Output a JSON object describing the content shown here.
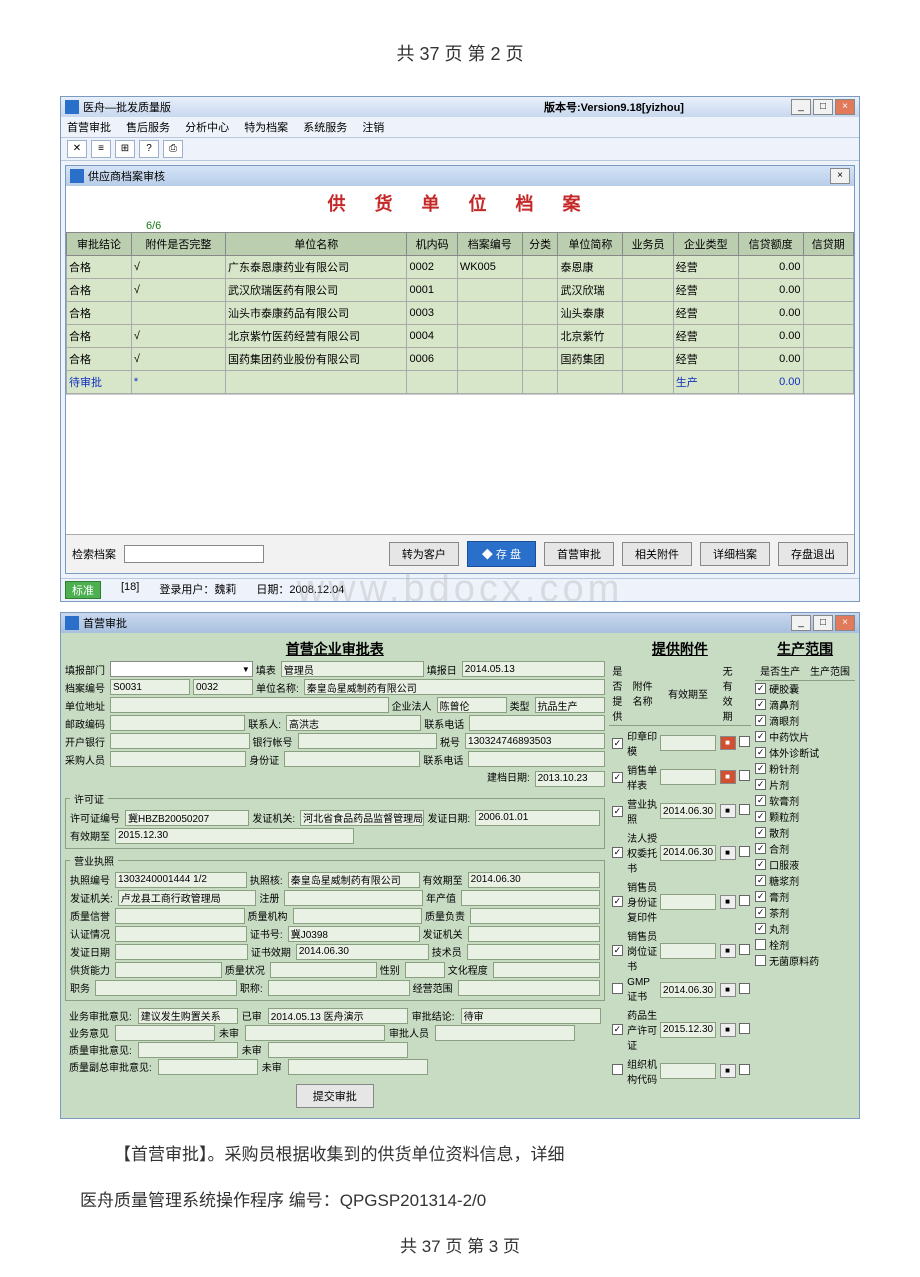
{
  "page_top": "共 37 页  第 2 页",
  "win1": {
    "title": "医舟—批发质量版",
    "version": "版本号:Version9.18[yizhou]",
    "menu": [
      "首营审批",
      "售后服务",
      "分析中心",
      "特为档案",
      "系统服务",
      "注销"
    ],
    "sub_title": "供应商档案审核",
    "doc_title": "供 货 单 位 档 案",
    "count": "6/6",
    "headers": [
      "审批结论",
      "附件是否完整",
      "单位名称",
      "机内码",
      "档案编号",
      "分类",
      "单位简称",
      "业务员",
      "企业类型",
      "信贷额度",
      "信贷期"
    ],
    "rows": [
      {
        "c0": "合格",
        "c1": "√",
        "c2": "广东泰恩康药业有限公司",
        "c3": "0002",
        "c4": "WK005",
        "c5": "",
        "c6": "泰恩康",
        "c7": "",
        "c8": "经营",
        "c9": "0.00"
      },
      {
        "c0": "合格",
        "c1": "√",
        "c2": "武汉欣瑞医药有限公司",
        "c3": "0001",
        "c4": "",
        "c5": "",
        "c6": "武汉欣瑞",
        "c7": "",
        "c8": "经营",
        "c9": "0.00"
      },
      {
        "c0": "合格",
        "c1": "",
        "c2": "汕头市泰康药品有限公司",
        "c3": "0003",
        "c4": "",
        "c5": "",
        "c6": "汕头泰康",
        "c7": "",
        "c8": "经营",
        "c9": "0.00"
      },
      {
        "c0": "合格",
        "c1": "√",
        "c2": "北京紫竹医药经营有限公司",
        "c3": "0004",
        "c4": "",
        "c5": "",
        "c6": "北京紫竹",
        "c7": "",
        "c8": "经营",
        "c9": "0.00"
      },
      {
        "c0": "合格",
        "c1": "√",
        "c2": "国药集团药业股份有限公司",
        "c3": "0006",
        "c4": "",
        "c5": "",
        "c6": "国药集团",
        "c7": "",
        "c8": "经营",
        "c9": "0.00"
      },
      {
        "c0": "待审批",
        "c1": "*",
        "c2": "",
        "c3": "",
        "c4": "",
        "c5": "",
        "c6": "",
        "c7": "",
        "c8": "生产",
        "c9": "0.00",
        "pending": true
      }
    ],
    "search_label": "检索档案",
    "btns": {
      "zkh": "转为客户",
      "save": "◆ 存 盘",
      "shyp": "首营审批",
      "xgfj": "相关附件",
      "xxda": "详细档案",
      "exit": "存盘退出"
    },
    "status": {
      "std": "标准",
      "n": "[18]",
      "user_l": "登录用户：",
      "user": "魏莉",
      "date_l": "日期：",
      "date": "2008.12.04"
    }
  },
  "watermark": "www.bdocx.com",
  "win2": {
    "title": "首营审批",
    "h1": "首营企业审批表",
    "h2": "提供附件",
    "h3": "生产范围",
    "top": {
      "tb_l": "填报部门",
      "tb": "",
      "r_l": "填表",
      "r": "管理员",
      "d1_l": "填报日",
      "d1": "2014.05.13",
      "d2_l": "建档日期:",
      "d2": "2013.10.23",
      "bh_l": "档案编号",
      "bh": "S0031",
      "code": "0032",
      "mc_l": "单位名称:",
      "mc": "秦皇岛星威制药有限公司",
      "dz_l": "单位地址",
      "qf_l": "企业法人",
      "qf": "陈曾伦",
      "lx_l": "类型",
      "lx": "抗品生产",
      "yb_l": "邮政编码",
      "lxr_l": "联系人:",
      "lxr": "高洪志",
      "dh_l": "联系电话",
      "kh_l": "开户银行",
      "yh_l": "银行帐号",
      "sh_l": "税号",
      "sh": "130324746893503",
      "cg_l": "采购人员",
      "sfz_l": "身份证",
      "dh2_l": "联系电话"
    },
    "xkz": {
      "legend": "许可证",
      "bh_l": "许可证编号",
      "bh": "冀HBZB20050207",
      "jg_l": "发证机关:",
      "jg": "河北省食品药品监督管理局",
      "rq_l": "发证日期:",
      "rq": "2006.01.01",
      "yx_l": "有效期至",
      "yx": "2015.12.30"
    },
    "yyzz": {
      "legend": "营业执照",
      "bh_l": "执照编号",
      "bh": "1303240001444 1/2",
      "jg_l": "执照核:",
      "jg": "秦皇岛星威制药有限公司",
      "yx_l": "有效期至",
      "yx": "2014.06.30",
      "fz_l": "发证机关:",
      "fz": "卢龙县工商行政管理局",
      "zc_l": "注册",
      "nz_l": "年产值",
      "zl_l": "质量信誉",
      "zljg_l": "质量机构",
      "fzr_l": "质量负责",
      "rz_l": "认证情况",
      "zs_l": "证书号:",
      "zs": "冀J0398",
      "rzjg_l": "发证机关",
      "fzrq_l": "发证日期",
      "zsyx_l": "证书效期",
      "zsyx": "2014.06.30",
      "jsy_l": "技术员",
      "gy_l": "供货能力",
      "zl2_l": "质量状况",
      "xb_l": "性别",
      "wh_l": "文化程度",
      "zc2_l": "职务",
      "zc3_l": "职称:",
      "jyfw_l": "经营范围"
    },
    "opinions": {
      "yw_l": "业务审批意见:",
      "yw": "建议发生购置关系",
      "qs_l": "已审",
      "qs": "2014.05.13 医舟演示",
      "jl_l": "审批结论:",
      "jl": "待审",
      "yw2_l": "业务意见",
      "wc1": "未审",
      "ry_l": "审批人员",
      "zl_l": "质量审批意见:",
      "wc2": "未审",
      "zlfr_l": "质量副总审批意见:",
      "wc3": "未审"
    },
    "attach_h": {
      "c0": "是否提供",
      "c1": "附件名称",
      "c2": "有效期至",
      "c3": "无有效期",
      "c4": ""
    },
    "attach": [
      {
        "ck": true,
        "name": "印章印模",
        "date": "",
        "btn": "red"
      },
      {
        "ck": true,
        "name": "销售单样表",
        "date": "",
        "btn": "red"
      },
      {
        "ck": true,
        "name": "营业执照",
        "date": "2014.06.30",
        "btn": "g"
      },
      {
        "ck": true,
        "name": "法人授权委托书",
        "date": "2014.06.30",
        "btn": "g"
      },
      {
        "ck": true,
        "name": "销售员身份证复印件",
        "date": "",
        "btn": "g"
      },
      {
        "ck": true,
        "name": "销售员岗位证书",
        "date": "",
        "btn": "g"
      },
      {
        "ck": false,
        "name": "GMP证书",
        "date": "2014.06.30",
        "btn": "g"
      },
      {
        "ck": true,
        "name": "药品生产许可证",
        "date": "2015.12.30",
        "btn": "g"
      },
      {
        "ck": false,
        "name": "组织机构代码",
        "date": "",
        "btn": "g"
      }
    ],
    "scope_h": {
      "c0": "是否生产",
      "c1": "生产范围"
    },
    "scope": [
      {
        "ck": true,
        "name": "硬胶囊"
      },
      {
        "ck": true,
        "name": "滴鼻剂"
      },
      {
        "ck": true,
        "name": "滴眼剂"
      },
      {
        "ck": true,
        "name": "中药饮片"
      },
      {
        "ck": true,
        "name": "体外诊断试"
      },
      {
        "ck": true,
        "name": "粉针剂"
      },
      {
        "ck": true,
        "name": "片剂"
      },
      {
        "ck": true,
        "name": "软膏剂"
      },
      {
        "ck": true,
        "name": "颗粒剂"
      },
      {
        "ck": true,
        "name": "散剂"
      },
      {
        "ck": true,
        "name": "合剂"
      },
      {
        "ck": true,
        "name": "口服液"
      },
      {
        "ck": true,
        "name": "糖浆剂"
      },
      {
        "ck": true,
        "name": "膏剂"
      },
      {
        "ck": true,
        "name": "茶剂"
      },
      {
        "ck": true,
        "name": "丸剂"
      },
      {
        "ck": false,
        "name": "栓剂"
      },
      {
        "ck": false,
        "name": "无菌原料药"
      }
    ],
    "submit": "提交审批"
  },
  "para1": "【首营审批】。采购员根据收集到的供货单位资料信息，详细",
  "para2": "医舟质量管理系统操作程序   编号：QPGSP201314-2/0",
  "page_bottom": "共 37 页  第 3 页"
}
